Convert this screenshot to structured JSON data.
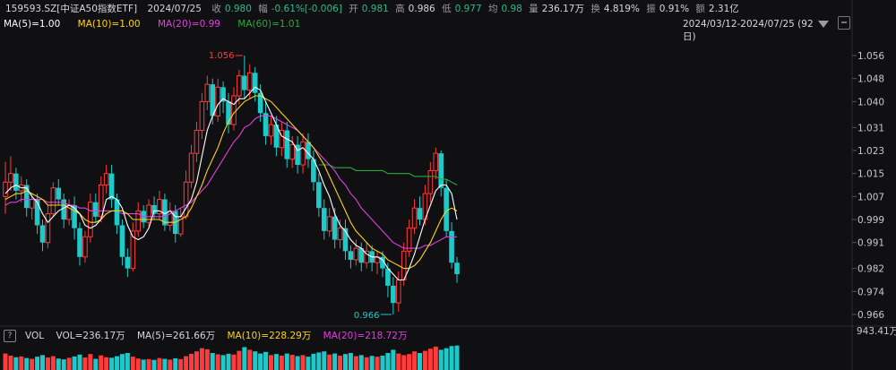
{
  "header": {
    "code": "159593.SZ[中证A50指数ETF]",
    "date": "2024/07/25",
    "close_label": "收",
    "close_value": "0.980",
    "change_label": "幅",
    "change_value": "-0.61%[-0.006]",
    "open_label": "开",
    "open_value": "0.981",
    "high_label": "高",
    "high_value": "0.986",
    "low_label": "低",
    "low_value": "0.977",
    "avg_label": "均",
    "avg_value": "0.98",
    "volume_label": "量",
    "volume_value": "236.17万",
    "turnover_label": "换",
    "turnover_value": "4.819%",
    "amplitude_label": "振",
    "amplitude_value": "0.91%",
    "amount_label": "额",
    "amount_value": "2.31亿"
  },
  "ma_legend": {
    "ma5": "MA(5)=1.00",
    "ma10": "MA(10)=1.00",
    "ma20": "MA(20)=0.99",
    "ma60": "MA(60)=1.01"
  },
  "range": {
    "label": "2024/03/12-2024/07/25 (92日)"
  },
  "volume_panel": {
    "icon_glyph": "?",
    "name": "VOL",
    "vol": "VOL=236.17万",
    "ma5": "MA(5)=261.66万",
    "ma10": "MA(10)=228.29万",
    "ma20": "MA(20)=218.72万",
    "axis_value": "943.41万"
  },
  "colors": {
    "up": "#ff3b3b",
    "down": "#1ec9c9",
    "ma5": "#ffffff",
    "ma10": "#ffd21a",
    "ma20": "#e040e0",
    "ma60": "#2aa840"
  },
  "chart_data": {
    "type": "candlestick",
    "y_ticks": [
      "1.056",
      "1.048",
      "1.040",
      "1.031",
      "1.023",
      "1.015",
      "1.007",
      "0.999",
      "0.991",
      "0.982",
      "0.974",
      "0.966"
    ],
    "ylim": [
      0.962,
      1.064
    ],
    "high_annotation": "1.056",
    "low_annotation": "0.966",
    "candles": [
      [
        1.007,
        1.012,
        1.019,
        1.001
      ],
      [
        1.012,
        1.015,
        1.021,
        1.009
      ],
      [
        1.015,
        1.009,
        1.017,
        1.006
      ],
      [
        1.009,
        1.011,
        1.014,
        1.005
      ],
      [
        1.011,
        1.003,
        1.013,
        1.0
      ],
      [
        1.003,
        1.006,
        1.008,
        0.999
      ],
      [
        1.006,
        0.997,
        1.008,
        0.994
      ],
      [
        0.997,
        0.991,
        0.999,
        0.988
      ],
      [
        0.991,
        1.001,
        1.004,
        0.989
      ],
      [
        1.001,
        1.01,
        1.012,
        1.0
      ],
      [
        1.01,
        1.006,
        1.013,
        1.004
      ],
      [
        1.006,
        0.999,
        1.008,
        0.996
      ],
      [
        0.999,
        1.004,
        1.006,
        0.997
      ],
      [
        1.004,
        0.996,
        1.007,
        0.992
      ],
      [
        0.996,
        0.986,
        0.998,
        0.983
      ],
      [
        0.986,
        0.993,
        0.995,
        0.984
      ],
      [
        0.993,
        1.005,
        1.008,
        0.991
      ],
      [
        1.005,
        1.0,
        1.008,
        0.998
      ],
      [
        1.0,
        1.011,
        1.014,
        0.998
      ],
      [
        1.011,
        1.015,
        1.018,
        1.008
      ],
      [
        1.015,
        1.006,
        1.018,
        1.003
      ],
      [
        1.006,
        0.997,
        1.008,
        0.994
      ],
      [
        0.997,
        0.986,
        0.999,
        0.983
      ],
      [
        0.986,
        0.982,
        0.989,
        0.979
      ],
      [
        0.982,
        0.995,
        0.998,
        0.981
      ],
      [
        0.995,
        1.002,
        1.005,
        0.993
      ],
      [
        1.002,
        0.998,
        1.004,
        0.996
      ],
      [
        0.998,
        1.004,
        1.006,
        0.996
      ],
      [
        1.004,
        1.001,
        1.007,
        0.999
      ],
      [
        1.001,
        1.006,
        1.009,
        0.999
      ],
      [
        1.006,
        0.997,
        1.008,
        0.995
      ],
      [
        0.997,
        1.002,
        1.005,
        0.995
      ],
      [
        1.002,
        0.994,
        1.004,
        0.991
      ],
      [
        0.994,
        1.0,
        1.003,
        0.993
      ],
      [
        1.0,
        1.012,
        1.016,
        0.999
      ],
      [
        1.012,
        1.022,
        1.025,
        1.01
      ],
      [
        1.022,
        1.03,
        1.033,
        1.019
      ],
      [
        1.03,
        1.04,
        1.043,
        1.027
      ],
      [
        1.04,
        1.046,
        1.049,
        1.037
      ],
      [
        1.046,
        1.035,
        1.048,
        1.032
      ],
      [
        1.035,
        1.045,
        1.048,
        1.033
      ],
      [
        1.045,
        1.04,
        1.047,
        1.036
      ],
      [
        1.04,
        1.032,
        1.043,
        1.029
      ],
      [
        1.032,
        1.042,
        1.045,
        1.03
      ],
      [
        1.042,
        1.049,
        1.051,
        1.039
      ],
      [
        1.049,
        1.044,
        1.056,
        1.041
      ],
      [
        1.044,
        1.05,
        1.053,
        1.041
      ],
      [
        1.05,
        1.043,
        1.052,
        1.04
      ],
      [
        1.043,
        1.036,
        1.046,
        1.033
      ],
      [
        1.036,
        1.028,
        1.04,
        1.025
      ],
      [
        1.028,
        1.032,
        1.035,
        1.025
      ],
      [
        1.032,
        1.024,
        1.035,
        1.021
      ],
      [
        1.024,
        1.03,
        1.033,
        1.021
      ],
      [
        1.03,
        1.02,
        1.033,
        1.017
      ],
      [
        1.02,
        1.025,
        1.028,
        1.017
      ],
      [
        1.025,
        1.018,
        1.028,
        1.015
      ],
      [
        1.018,
        1.026,
        1.029,
        1.015
      ],
      [
        1.026,
        1.02,
        1.029,
        1.017
      ],
      [
        1.02,
        1.012,
        1.023,
        1.009
      ],
      [
        1.012,
        1.003,
        1.015,
        1.0
      ],
      [
        1.003,
        0.995,
        1.006,
        0.992
      ],
      [
        0.995,
        1.0,
        1.003,
        0.993
      ],
      [
        1.0,
        0.992,
        1.003,
        0.989
      ],
      [
        0.992,
        0.996,
        0.999,
        0.989
      ],
      [
        0.996,
        0.988,
        0.999,
        0.985
      ],
      [
        0.988,
        0.985,
        0.99,
        0.982
      ],
      [
        0.985,
        0.989,
        0.992,
        0.983
      ],
      [
        0.989,
        0.984,
        0.991,
        0.981
      ],
      [
        0.984,
        0.988,
        0.991,
        0.982
      ],
      [
        0.988,
        0.984,
        0.99,
        0.981
      ],
      [
        0.984,
        0.986,
        0.988,
        0.98
      ],
      [
        0.986,
        0.982,
        0.988,
        0.979
      ],
      [
        0.982,
        0.976,
        0.984,
        0.972
      ],
      [
        0.976,
        0.97,
        0.979,
        0.966
      ],
      [
        0.97,
        0.978,
        0.981,
        0.967
      ],
      [
        0.978,
        0.988,
        0.991,
        0.976
      ],
      [
        0.988,
        0.996,
        0.999,
        0.986
      ],
      [
        0.996,
        1.003,
        1.006,
        0.994
      ],
      [
        1.003,
        0.999,
        1.007,
        0.997
      ],
      [
        0.999,
        1.008,
        1.011,
        0.997
      ],
      [
        1.008,
        1.016,
        1.019,
        1.005
      ],
      [
        1.016,
        1.022,
        1.024,
        1.013
      ],
      [
        1.022,
        1.01,
        1.023,
        1.007
      ],
      [
        1.01,
        0.995,
        1.013,
        0.993
      ],
      [
        0.995,
        0.984,
        0.998,
        0.982
      ],
      [
        0.984,
        0.98,
        0.986,
        0.977
      ]
    ],
    "ma5": [
      1.008,
      1.01,
      1.011,
      1.01,
      1.01,
      1.007,
      1.005,
      1.001,
      0.998,
      1.0,
      1.002,
      1.003,
      1.004,
      1.003,
      1.001,
      0.997,
      0.996,
      0.997,
      0.999,
      1.006,
      1.007,
      1.006,
      1.003,
      0.997,
      0.993,
      0.992,
      0.993,
      0.996,
      1.002,
      1.002,
      1.001,
      1.002,
      1.0,
      1.0,
      1.003,
      1.006,
      1.012,
      1.021,
      1.03,
      1.035,
      1.039,
      1.041,
      1.04,
      1.039,
      1.041,
      1.041,
      1.043,
      1.045,
      1.044,
      1.04,
      1.036,
      1.032,
      1.028,
      1.027,
      1.026,
      1.023,
      1.024,
      1.022,
      1.02,
      1.016,
      1.011,
      1.007,
      1.001,
      0.997,
      0.995,
      0.992,
      0.99,
      0.989,
      0.987,
      0.986,
      0.986,
      0.985,
      0.982,
      0.98,
      0.978,
      0.978,
      0.982,
      0.987,
      0.993,
      0.999,
      1.004,
      1.009,
      1.011,
      1.011,
      1.008,
      0.999
    ],
    "ma10": [
      1.006,
      1.007,
      1.008,
      1.008,
      1.009,
      1.008,
      1.007,
      1.006,
      1.004,
      1.004,
      1.004,
      1.004,
      1.003,
      1.002,
      1.001,
      0.999,
      0.998,
      0.998,
      0.999,
      1.001,
      1.002,
      1.002,
      1.002,
      1.001,
      0.999,
      0.999,
      0.999,
      0.999,
      0.999,
      0.999,
      0.998,
      0.998,
      0.998,
      0.999,
      1.0,
      1.003,
      1.007,
      1.011,
      1.016,
      1.02,
      1.024,
      1.029,
      1.033,
      1.036,
      1.038,
      1.04,
      1.041,
      1.042,
      1.042,
      1.041,
      1.04,
      1.038,
      1.036,
      1.034,
      1.032,
      1.03,
      1.028,
      1.026,
      1.024,
      1.021,
      1.018,
      1.014,
      1.01,
      1.006,
      1.002,
      0.998,
      0.995,
      0.993,
      0.991,
      0.989,
      0.988,
      0.987,
      0.985,
      0.984,
      0.983,
      0.982,
      0.982,
      0.983,
      0.985,
      0.988,
      0.991,
      0.995,
      0.999,
      1.002,
      1.003,
      1.002
    ],
    "ma20": [
      1.004,
      1.005,
      1.005,
      1.006,
      1.006,
      1.006,
      1.006,
      1.006,
      1.005,
      1.005,
      1.005,
      1.005,
      1.004,
      1.004,
      1.003,
      1.003,
      1.002,
      1.002,
      1.002,
      1.002,
      1.002,
      1.002,
      1.001,
      1.001,
      1.001,
      1.001,
      1.0,
      1.0,
      1.0,
      1.0,
      1.0,
      1.001,
      1.002,
      1.003,
      1.004,
      1.005,
      1.007,
      1.009,
      1.011,
      1.014,
      1.017,
      1.02,
      1.023,
      1.026,
      1.028,
      1.031,
      1.032,
      1.034,
      1.035,
      1.035,
      1.035,
      1.034,
      1.033,
      1.032,
      1.031,
      1.03,
      1.028,
      1.026,
      1.024,
      1.022,
      1.02,
      1.018,
      1.016,
      1.013,
      1.011,
      1.008,
      1.006,
      1.003,
      1.001,
      0.999,
      0.997,
      0.995,
      0.993,
      0.991,
      0.99,
      0.989,
      0.989,
      0.989,
      0.989,
      0.99,
      0.99,
      0.991,
      0.992,
      0.993,
      0.993,
      0.993
    ],
    "ma60": [
      null,
      null,
      null,
      null,
      null,
      null,
      null,
      null,
      null,
      null,
      null,
      null,
      null,
      null,
      null,
      null,
      null,
      null,
      null,
      null,
      null,
      null,
      null,
      null,
      null,
      null,
      null,
      null,
      null,
      null,
      null,
      null,
      null,
      null,
      null,
      null,
      null,
      null,
      null,
      null,
      null,
      null,
      null,
      null,
      null,
      null,
      null,
      null,
      null,
      null,
      null,
      null,
      null,
      null,
      null,
      null,
      null,
      null,
      null,
      1.018,
      1.018,
      1.018,
      1.017,
      1.017,
      1.017,
      1.017,
      1.016,
      1.016,
      1.016,
      1.016,
      1.016,
      1.016,
      1.015,
      1.015,
      1.015,
      1.015,
      1.015,
      1.014,
      1.014,
      1.014,
      1.014,
      1.014,
      1.013,
      1.013,
      1.012,
      1.011
    ],
    "volumes": [
      620,
      540,
      480,
      510,
      450,
      420,
      500,
      560,
      470,
      520,
      430,
      400,
      460,
      510,
      580,
      470,
      600,
      420,
      550,
      480,
      460,
      520,
      600,
      640,
      500,
      430,
      390,
      410,
      380,
      450,
      420,
      390,
      440,
      410,
      520,
      610,
      700,
      820,
      780,
      640,
      590,
      560,
      610,
      580,
      720,
      860,
      760,
      700,
      620,
      680,
      560,
      600,
      540,
      620,
      570,
      520,
      560,
      500,
      610,
      660,
      700,
      580,
      620,
      540,
      600,
      640,
      520,
      560,
      480,
      530,
      500,
      540,
      640,
      760,
      620,
      560,
      600,
      700,
      640,
      720,
      800,
      880,
      760,
      820,
      900,
      920
    ]
  }
}
